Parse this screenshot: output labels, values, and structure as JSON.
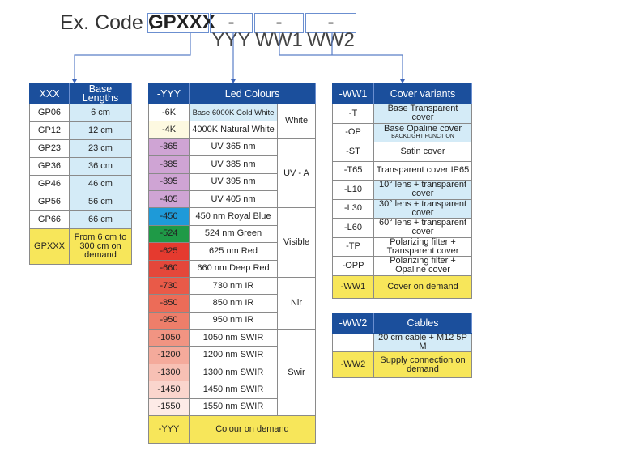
{
  "header": {
    "label": "Ex. Code :",
    "parts": [
      "GPXXX",
      "-YYY",
      "-WW1",
      "-WW2"
    ]
  },
  "colors": {
    "header": "#1b4f9c",
    "highlight": "#d4ebf7",
    "on_demand": "#f7e65a",
    "connector": "#5b7fc8"
  },
  "lengths": {
    "headers": [
      "XXX",
      "Base Lengths"
    ],
    "rows": [
      [
        "GP06",
        "6 cm"
      ],
      [
        "GP12",
        "12 cm"
      ],
      [
        "GP23",
        "23 cm"
      ],
      [
        "GP36",
        "36 cm"
      ],
      [
        "GP46",
        "46 cm"
      ],
      [
        "GP56",
        "56 cm"
      ],
      [
        "GP66",
        "66 cm"
      ]
    ],
    "demand": [
      "GPXXX",
      "From 6 cm to 300 cm on demand"
    ]
  },
  "colours": {
    "headers": [
      "-YYY",
      "Led Colours"
    ],
    "rows": [
      {
        "code": "-6K",
        "name": "Base 6000K Cold White",
        "color": "#ffffff"
      },
      {
        "code": "-4K",
        "name": "4000K Natural White",
        "color": "#fdf9e1"
      },
      {
        "code": "-365",
        "name": "UV 365 nm",
        "color": "#cfa4d4"
      },
      {
        "code": "-385",
        "name": "UV 385 nm",
        "color": "#cfa4d4"
      },
      {
        "code": "-395",
        "name": "UV 395 nm",
        "color": "#cfa4d4"
      },
      {
        "code": "-405",
        "name": "UV 405 nm",
        "color": "#cfa4d4"
      },
      {
        "code": "-450",
        "name": "450 nm Royal Blue",
        "color": "#1e9ad8"
      },
      {
        "code": "-524",
        "name": "524 nm Green",
        "color": "#1f9a47"
      },
      {
        "code": "-625",
        "name": "625 nm Red",
        "color": "#e53a2f"
      },
      {
        "code": "-660",
        "name": "660 nm Deep Red",
        "color": "#e4473a"
      },
      {
        "code": "-730",
        "name": "730 nm IR",
        "color": "#e95a48"
      },
      {
        "code": "-850",
        "name": "850 nm IR",
        "color": "#ec6c58"
      },
      {
        "code": "-950",
        "name": "950 nm IR",
        "color": "#ee7e6a"
      },
      {
        "code": "-1050",
        "name": "1050 nm SWIR",
        "color": "#f19482"
      },
      {
        "code": "-1200",
        "name": "1200 nm SWIR",
        "color": "#f4aa9b"
      },
      {
        "code": "-1300",
        "name": "1300 nm SWIR",
        "color": "#f7c0b4"
      },
      {
        "code": "-1450",
        "name": "1450 nm SWIR",
        "color": "#fad5cd"
      },
      {
        "code": "-1550",
        "name": "1550 nm SWIR",
        "color": "#fdebe7"
      }
    ],
    "groups": [
      {
        "label": "White",
        "span": 2
      },
      {
        "label": "UV - A",
        "span": 4
      },
      {
        "label": "Visible",
        "span": 4
      },
      {
        "label": "Nir",
        "span": 3
      },
      {
        "label": "Swir",
        "span": 5
      }
    ],
    "demand": [
      "-YYY",
      "Colour on demand"
    ]
  },
  "covers": {
    "headers": [
      "-WW1",
      "Cover variants"
    ],
    "rows": [
      {
        "code": "-T",
        "name": "Base Transparent cover",
        "hl": true
      },
      {
        "code": "-OP",
        "name": "Base Opaline cover",
        "sub": "BACKLIGHT FUNCTION",
        "hl": true
      },
      {
        "code": "-ST",
        "name": "Satin cover",
        "hl": false
      },
      {
        "code": "-T65",
        "name": "Transparent cover IP65",
        "hl": false
      },
      {
        "code": "-L10",
        "name": "10° lens + transparent cover",
        "hl": true
      },
      {
        "code": "-L30",
        "name": "30° lens + transparent cover",
        "hl": true
      },
      {
        "code": "-L60",
        "name": "60° lens + transparent cover",
        "hl": false
      },
      {
        "code": "-TP",
        "name": "Polarizing filter + Transparent cover",
        "hl": false
      },
      {
        "code": "-OPP",
        "name": "Polarizing filter + Opaline cover",
        "hl": false
      }
    ],
    "demand": [
      "-WW1",
      "Cover on demand"
    ]
  },
  "cables": {
    "headers": [
      "-WW2",
      "Cables"
    ],
    "rows": [
      [
        "",
        "20 cm cable + M12 5P M"
      ]
    ],
    "demand": [
      "-WW2",
      "Supply connection on demand"
    ]
  }
}
